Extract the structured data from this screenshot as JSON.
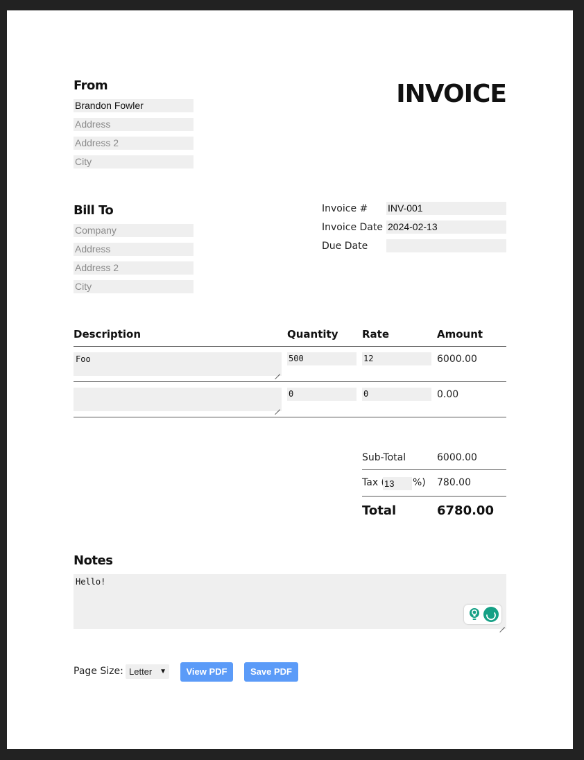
{
  "invoice": {
    "title": "INVOICE"
  },
  "from": {
    "heading": "From",
    "name": "Brandon Fowler",
    "address_placeholder": "Address",
    "address2_placeholder": "Address 2",
    "city_placeholder": "City"
  },
  "bill_to": {
    "heading": "Bill To",
    "company_placeholder": "Company",
    "address_placeholder": "Address",
    "address2_placeholder": "Address 2",
    "city_placeholder": "City"
  },
  "meta": {
    "invoice_number_label": "Invoice #",
    "invoice_number": "INV-001",
    "invoice_date_label": "Invoice Date",
    "invoice_date": "2024-02-13",
    "due_date_label": "Due Date",
    "due_date": ""
  },
  "table": {
    "headers": {
      "description": "Description",
      "quantity": "Quantity",
      "rate": "Rate",
      "amount": "Amount"
    },
    "rows": [
      {
        "description": "Foo",
        "quantity": "500",
        "rate": "12",
        "amount": "6000.00"
      },
      {
        "description": "",
        "quantity": "0",
        "rate": "0",
        "amount": "0.00"
      }
    ]
  },
  "totals": {
    "subtotal_label": "Sub-Total",
    "subtotal": "6000.00",
    "tax_label_prefix": "Tax (",
    "tax_rate": "13",
    "tax_label_suffix": "%)",
    "tax": "780.00",
    "total_label": "Total",
    "total": "6780.00"
  },
  "notes": {
    "heading": "Notes",
    "text": "Hello!"
  },
  "footer": {
    "page_size_label": "Page Size:",
    "page_size_selected": "Letter",
    "view_pdf": "View PDF",
    "save_pdf": "Save PDF"
  },
  "icons": {
    "grammarly_bulb": "lightbulb-icon",
    "grammarly_logo": "grammarly-icon"
  },
  "colors": {
    "button": "#5b9bf8",
    "field": "#efefef",
    "grammarly": "#15a085"
  }
}
